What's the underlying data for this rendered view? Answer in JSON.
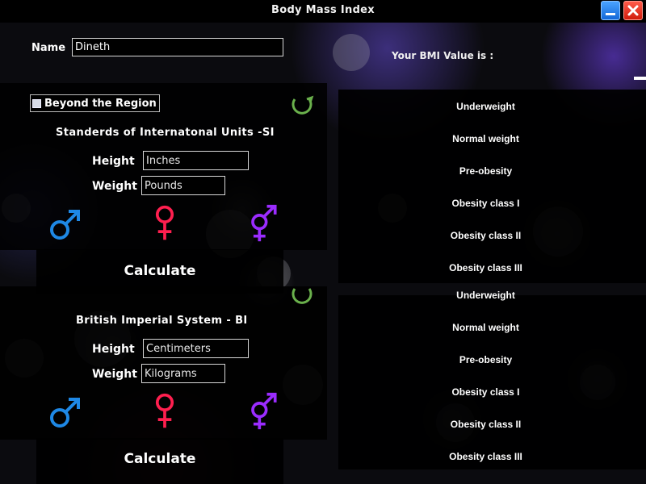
{
  "window": {
    "title": "Body Mass Index",
    "minimize_icon": "minimize-icon",
    "close_icon": "close-icon"
  },
  "name_field": {
    "label": "Name",
    "value": "Dineth"
  },
  "result": {
    "label": "Your BMI Value is :"
  },
  "overlay_section": {
    "checkbox_label": "Beyond the Region",
    "system_title": "Standerds of Internatonal Units -SI",
    "height_label": "Height",
    "height_value": "Inches",
    "weight_label": "Weight",
    "weight_value": "Pounds",
    "calculate_label": "Calculate",
    "bmi_categories": [
      "Underweight",
      "Normal weight",
      "Pre-obesity",
      "Obesity class I",
      "Obesity class II",
      "Obesity class III"
    ]
  },
  "base_section": {
    "system_title": "British Imperial System - BI",
    "height_label": "Height",
    "height_value": "Centimeters",
    "weight_label": "Weight",
    "weight_value": "Kilograms",
    "calculate_label": "Calculate",
    "bmi_categories": [
      "Underweight",
      "Normal weight",
      "Pre-obesity",
      "Obesity class I",
      "Obesity class II",
      "Obesity class III"
    ]
  },
  "colors": {
    "male": "#1e88e5",
    "female": "#ff1f4f",
    "other": "#9b2cff",
    "refresh": "#6ab04c"
  }
}
